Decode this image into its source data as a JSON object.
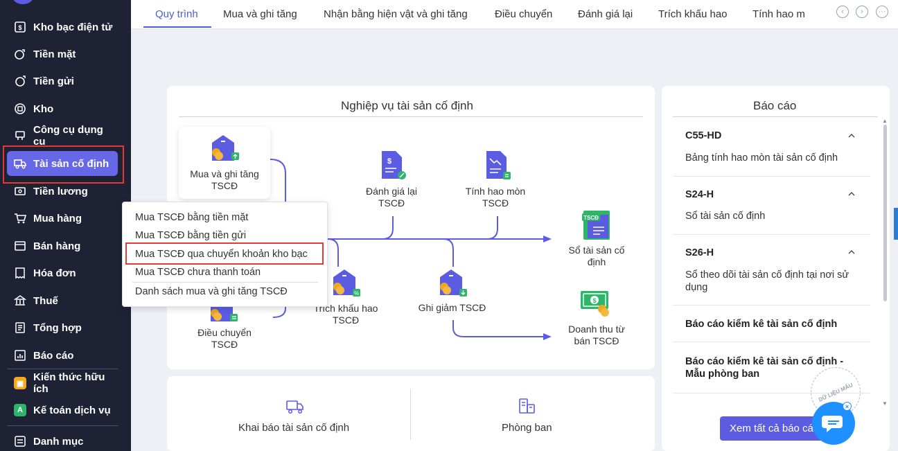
{
  "sidebar": {
    "items": [
      {
        "label": "Kho bạc điện tử",
        "icon": "treasury-icon"
      },
      {
        "label": "Tiền mặt",
        "icon": "cash-icon"
      },
      {
        "label": "Tiền gửi",
        "icon": "deposit-icon"
      },
      {
        "label": "Kho",
        "icon": "warehouse-icon"
      },
      {
        "label": "Công cụ dụng cụ",
        "icon": "tools-icon"
      },
      {
        "label": "Tài sản cố định",
        "icon": "fixed-asset-icon"
      },
      {
        "label": "Tiền lương",
        "icon": "salary-icon"
      },
      {
        "label": "Mua hàng",
        "icon": "cart-icon"
      },
      {
        "label": "Bán hàng",
        "icon": "sales-icon"
      },
      {
        "label": "Hóa đơn",
        "icon": "invoice-icon"
      },
      {
        "label": "Thuế",
        "icon": "tax-icon"
      },
      {
        "label": "Tổng hợp",
        "icon": "summary-icon"
      },
      {
        "label": "Báo cáo",
        "icon": "report-icon"
      },
      {
        "label": "Kiến thức hữu ích",
        "icon": "knowledge-icon"
      },
      {
        "label": "Kế toán dịch vụ",
        "icon": "accounting-service-icon"
      },
      {
        "label": "Danh mục",
        "icon": "catalog-icon"
      }
    ],
    "active_index": 5,
    "colors": {
      "bg": "#1f2235",
      "active": "#6668e8",
      "highlight": "#e53935"
    }
  },
  "tabs": {
    "items": [
      "Quy trình",
      "Mua và ghi tăng",
      "Nhận bằng hiện vật và ghi tăng",
      "Điều chuyển",
      "Đánh giá lại",
      "Trích khấu hao",
      "Tính hao m"
    ],
    "active_index": 0
  },
  "flow": {
    "title": "Nghiệp vụ tài sản cố định",
    "nodes": {
      "buy": [
        "Mua và ghi tăng",
        "TSCĐ"
      ],
      "revalue": [
        "Đánh giá lại",
        "TSCĐ"
      ],
      "depreciation_calc": [
        "Tính hao mòn",
        "TSCĐ"
      ],
      "ledger": [
        "Sổ tài sản cố",
        "định"
      ],
      "depreciation": [
        "Trích khấu hao",
        "TSCĐ"
      ],
      "decrease": [
        "Ghi giảm TSCĐ"
      ],
      "transfer": [
        "Điều chuyển",
        "TSCĐ"
      ],
      "revenue": [
        "Doanh thu từ",
        "bán TSCĐ"
      ]
    },
    "ledger_badge": "TSCĐ"
  },
  "dropdown": {
    "items": [
      "Mua TSCĐ bằng tiền mặt",
      "Mua TSCĐ bằng tiền gửi",
      "Mua TSCĐ qua chuyển khoản kho bạc",
      "Mua TSCĐ chưa thanh toán",
      "Danh sách mua và ghi tăng TSCĐ"
    ],
    "highlighted_index": 2
  },
  "bottom": {
    "items": [
      "Khai báo tài sản cố định",
      "Phòng ban"
    ]
  },
  "reports": {
    "title": "Báo cáo",
    "items": [
      {
        "code": "C55-HD",
        "desc": "Bảng tính hao mòn tài sản cố định"
      },
      {
        "code": "S24-H",
        "desc": "Sổ tài sản cố định"
      },
      {
        "code": "S26-H",
        "desc": "Sổ theo dõi tài sản cố định tại nơi sử dụng"
      }
    ],
    "bold_items": [
      "Báo cáo kiểm kê tài sản cố định",
      "Báo cáo kiểm kê tài sản cố định - Mẫu phòng ban"
    ],
    "view_all": "Xem tất cả báo cáo"
  },
  "watermark": "DỮ LIỆU MẪU",
  "accent": "#5b5ce2"
}
